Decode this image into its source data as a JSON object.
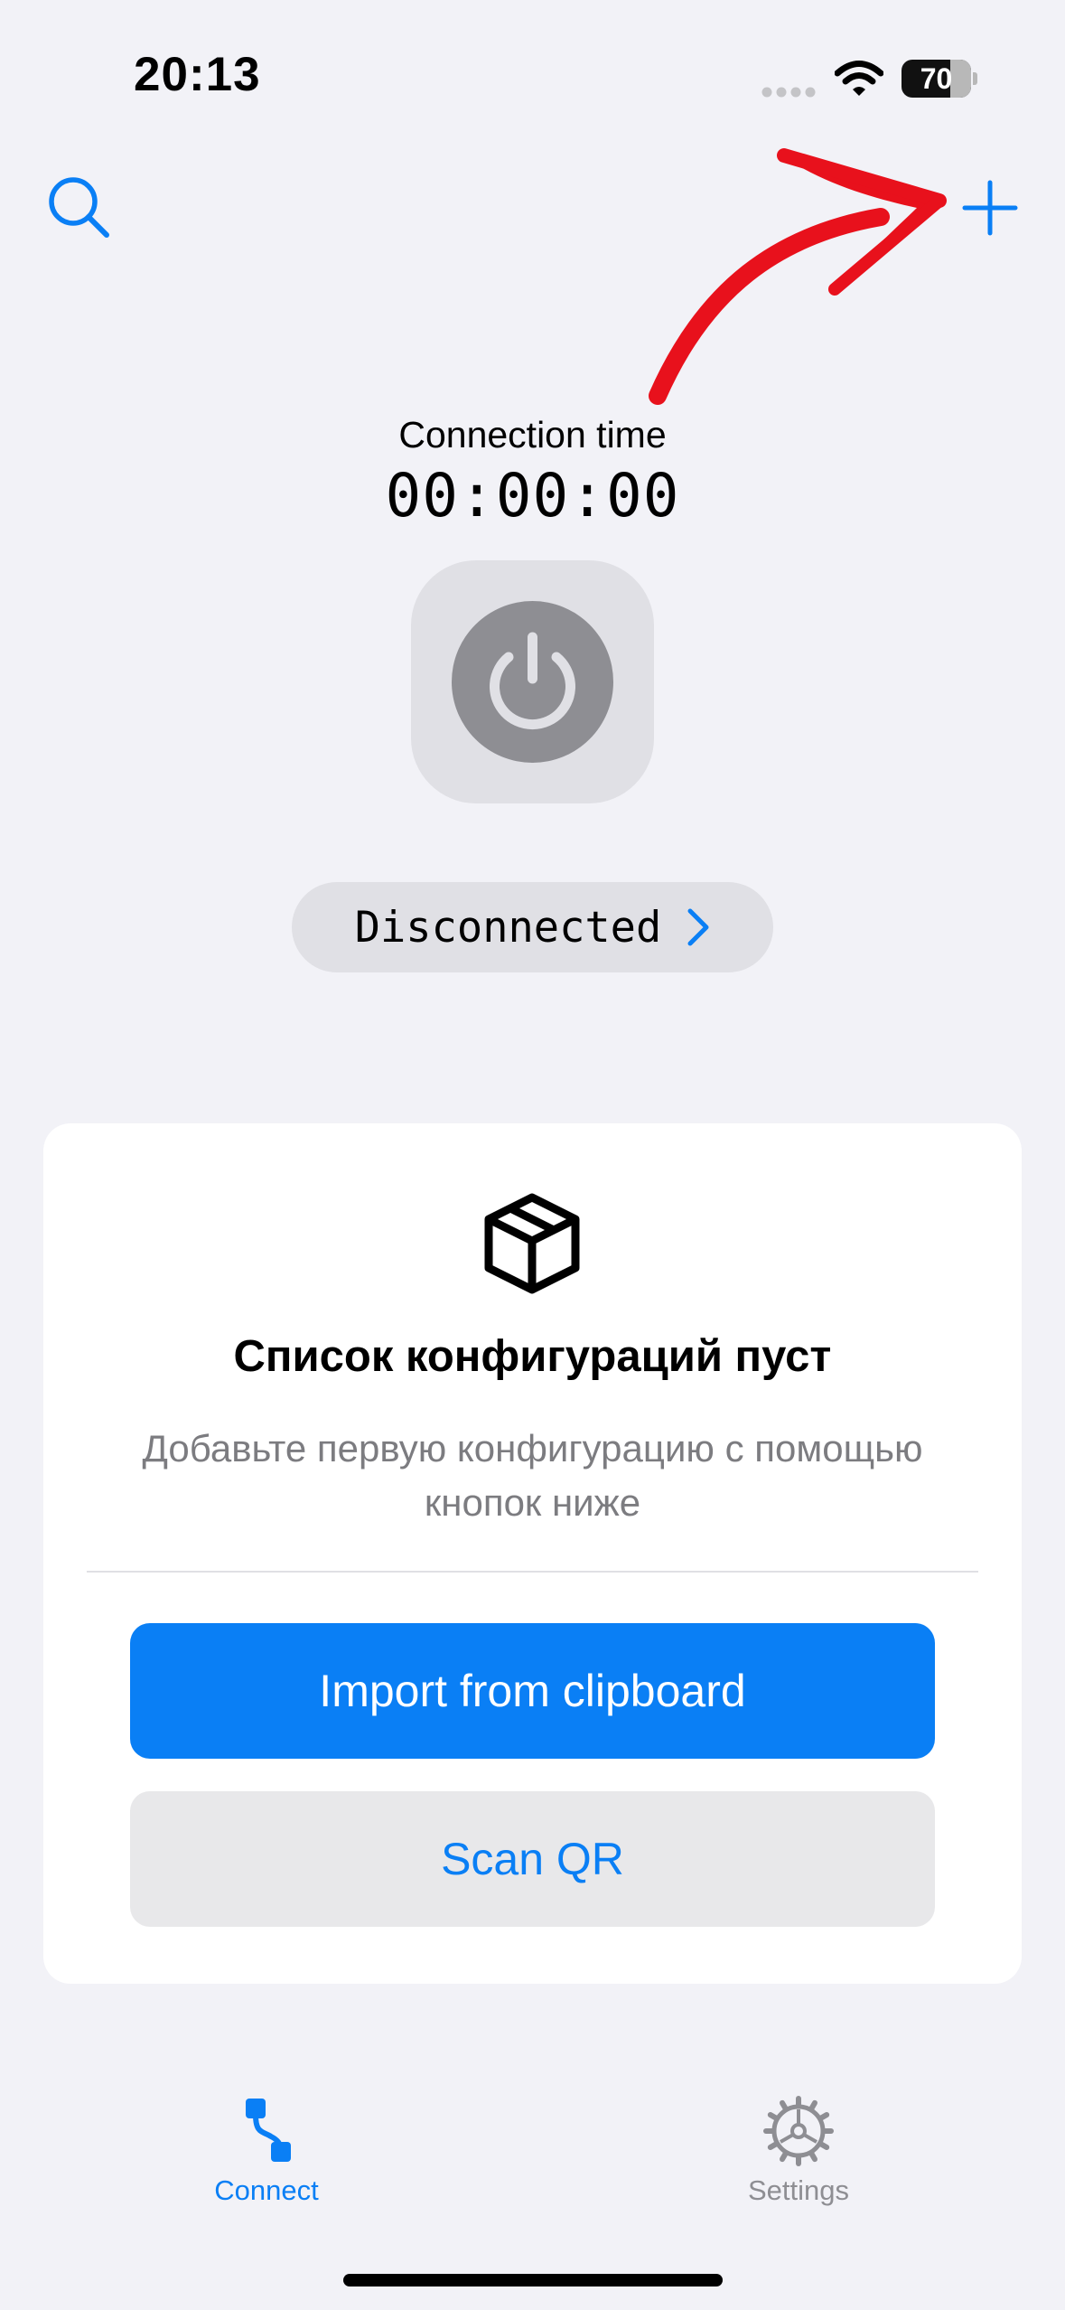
{
  "status_bar": {
    "time": "20:13",
    "battery_percent": "70",
    "battery_level": 0.7,
    "icons": [
      "cellular-dots-icon",
      "wifi-icon",
      "battery-icon"
    ]
  },
  "nav": {
    "left_icon": "search-icon",
    "right_icon": "plus-icon",
    "annotation_color": "#e8111c"
  },
  "connection": {
    "label": "Connection time",
    "timer": "00:00:00",
    "power_icon": "power-icon",
    "status": "Disconnected"
  },
  "empty_state": {
    "icon": "box-icon",
    "title": "Список конфигураций пуст",
    "subtitle": "Добавьте первую конфигурацию с помощью кнопок ниже",
    "primary_button": "Import from clipboard",
    "secondary_button": "Scan QR"
  },
  "tabs": [
    {
      "label": "Connect",
      "icon": "connect-icon",
      "active": true
    },
    {
      "label": "Settings",
      "icon": "gear-icon",
      "active": false
    }
  ],
  "colors": {
    "accent": "#0a7ff5",
    "background": "#f2f2f7",
    "power_idle": "#8e8e93",
    "annotation": "#e8111c"
  }
}
